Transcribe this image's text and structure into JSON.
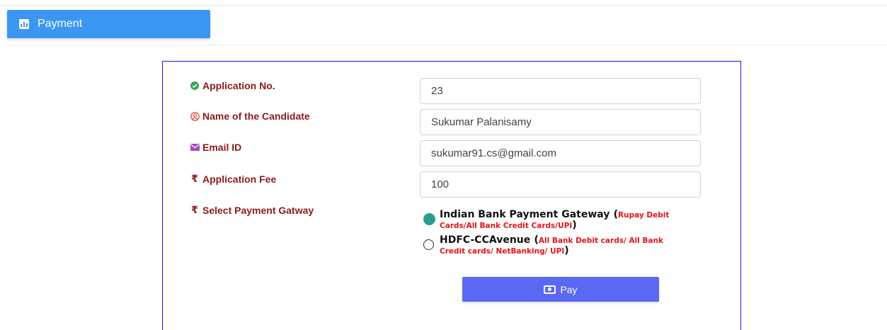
{
  "header": {
    "title": "Payment",
    "icon": "bar-chart-icon"
  },
  "form": {
    "fields": [
      {
        "label": "Application No.",
        "icon": "check-circle-icon",
        "value": "23"
      },
      {
        "label": "Name of the Candidate",
        "icon": "user-circle-icon",
        "value": "Sukumar Palanisamy"
      },
      {
        "label": "Email ID",
        "icon": "envelope-icon",
        "value": "sukumar91.cs@gmail.com"
      },
      {
        "label": "Application Fee",
        "icon": "rupee-icon",
        "value": "100"
      }
    ],
    "gateway_label": "Select Payment Gatway",
    "gateway_icon": "rupee-icon",
    "gateways": [
      {
        "name": "Indian Bank Payment Gateway",
        "desc": "Rupay Debit Cards/All Bank Credit Cards/UPI",
        "selected": true
      },
      {
        "name": "HDFC-CCAvenue",
        "desc": "All Bank Debit cards/ All Bank Credit cards/ NetBanking/ UPI",
        "selected": false
      }
    ],
    "pay_label": "Pay",
    "pay_icon": "money-bill-icon"
  },
  "colors": {
    "accent": "#3a96f2",
    "label": "#8b1a1a",
    "button": "#5b68f3",
    "selected_radio": "#2a9d8f",
    "card_border": "#1a1ad6",
    "warning_text": "#e3141a"
  }
}
